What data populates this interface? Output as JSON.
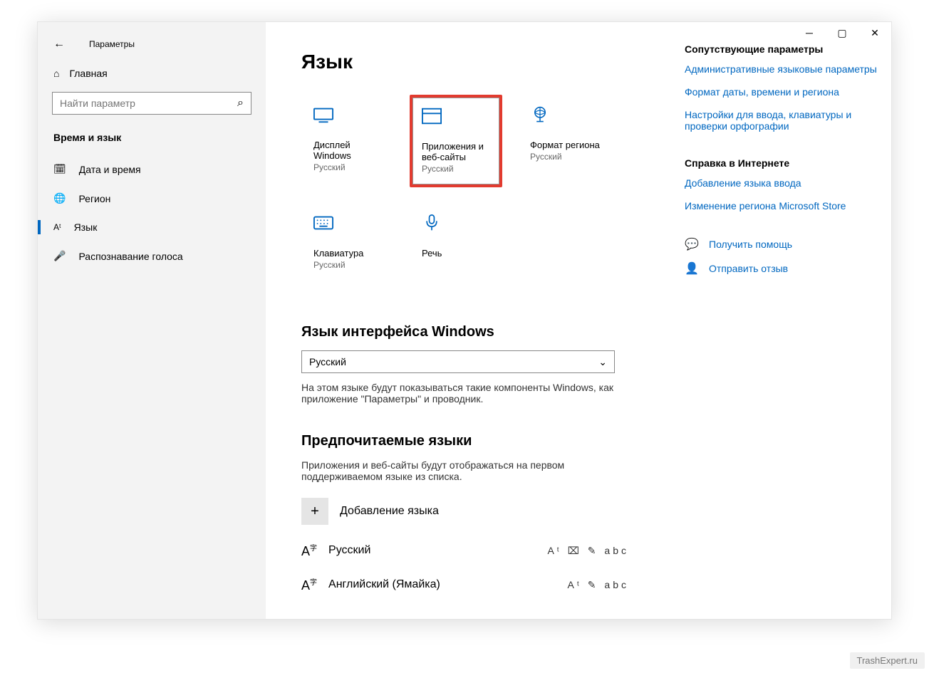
{
  "window": {
    "title": "Параметры"
  },
  "sidebar": {
    "home": "Главная",
    "search_placeholder": "Найти параметр",
    "group": "Время и язык",
    "items": [
      {
        "label": "Дата и время"
      },
      {
        "label": "Регион"
      },
      {
        "label": "Язык"
      },
      {
        "label": "Распознавание голоса"
      }
    ]
  },
  "main": {
    "heading": "Язык",
    "tiles": [
      {
        "label": "Дисплей Windows",
        "sub": "Русский"
      },
      {
        "label": "Приложения и веб-сайты",
        "sub": "Русский"
      },
      {
        "label": "Формат региона",
        "sub": "Русский"
      },
      {
        "label": "Клавиатура",
        "sub": "Русский"
      },
      {
        "label": "Речь",
        "sub": ""
      }
    ],
    "section1": {
      "title": "Язык интерфейса Windows",
      "value": "Русский",
      "desc": "На этом языке будут показываться такие компоненты Windows, как приложение \"Параметры\" и проводник."
    },
    "section2": {
      "title": "Предпочитаемые языки",
      "desc": "Приложения и веб-сайты будут отображаться на первом поддерживаемом языке из списка.",
      "add": "Добавление языка",
      "langs": [
        {
          "name": "Русский"
        },
        {
          "name": "Английский (Ямайка)"
        }
      ]
    }
  },
  "right": {
    "related_h": "Сопутствующие параметры",
    "related": [
      "Административные языковые параметры",
      "Формат даты, времени и региона",
      "Настройки для ввода, клавиатуры и проверки орфографии"
    ],
    "help_h": "Справка в Интернете",
    "help": [
      "Добавление языка ввода",
      "Изменение региона Microsoft Store"
    ],
    "actions": [
      "Получить помощь",
      "Отправить отзыв"
    ]
  },
  "watermark": "TrashExpert.ru"
}
